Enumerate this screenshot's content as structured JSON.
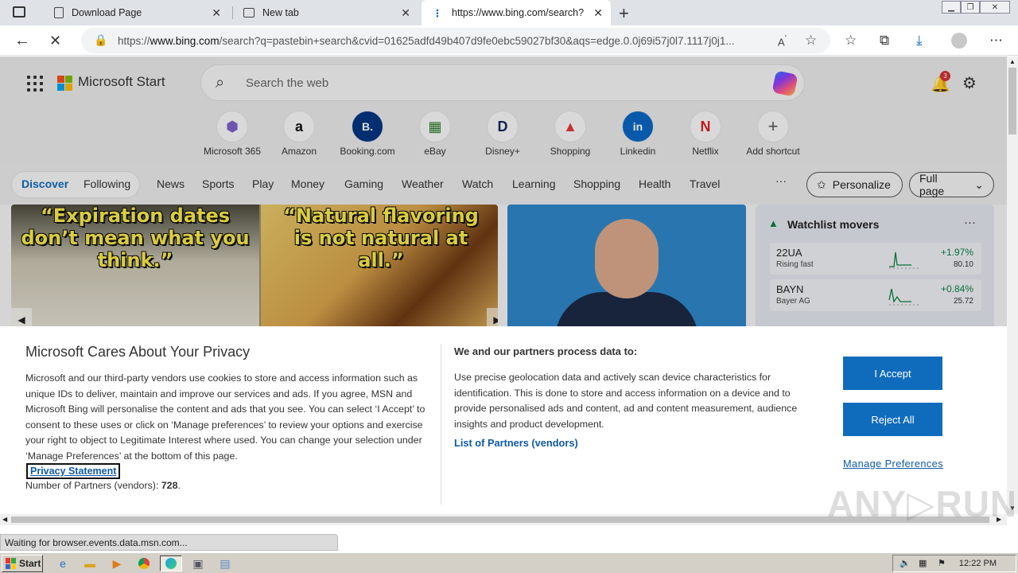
{
  "browser": {
    "tabs": [
      {
        "title": "Download Page"
      },
      {
        "title": "New tab"
      },
      {
        "title": "https://www.bing.com/search?"
      }
    ],
    "url_prefix": "https://",
    "url_host": "www.bing.com",
    "url_rest": "/search?q=pastebin+search&cvid=01625adfd49b407d9fe0ebc59027bf30&aqs=edge.0.0j69i57j0l7.1117j0j1..."
  },
  "header": {
    "brand": "Microsoft Start",
    "search_placeholder": "Search the web",
    "notification_count": "3"
  },
  "shortcuts": [
    {
      "label": "Microsoft 365",
      "glyph": "⬢",
      "color": "#7b61c9"
    },
    {
      "label": "Amazon",
      "glyph": "a",
      "color": "#111111"
    },
    {
      "label": "Booking.com",
      "glyph": "B.",
      "color": "#ffffff"
    },
    {
      "label": "eBay",
      "glyph": "▦",
      "color": "#2a7a2a"
    },
    {
      "label": "Disney+",
      "glyph": "D",
      "color": "#1a2a5a"
    },
    {
      "label": "Shopping",
      "glyph": "▲",
      "color": "#e03a3a"
    },
    {
      "label": "Linkedin",
      "glyph": "in",
      "color": "#ffffff"
    },
    {
      "label": "Netflix",
      "glyph": "N",
      "color": "#d81f26"
    },
    {
      "label": "Add shortcut",
      "glyph": "+",
      "color": "#555555"
    }
  ],
  "nav": {
    "discover": "Discover",
    "following": "Following",
    "items": [
      "News",
      "Sports",
      "Play",
      "Money",
      "Gaming",
      "Weather",
      "Watch",
      "Learning",
      "Shopping",
      "Health",
      "Travel"
    ],
    "more": "···",
    "personalize": "Personalize",
    "full_page": "Full page"
  },
  "feed": {
    "quote_left": "“Expiration dates don’t mean what you think.”",
    "quote_right": "“Natural flavoring is not natural at all.”"
  },
  "watchlist": {
    "title": "Watchlist movers",
    "rows": [
      {
        "symbol": "22UA",
        "sub": "Rising fast",
        "pct": "+1.97%",
        "value": "80.10"
      },
      {
        "symbol": "BAYN",
        "sub": "Bayer AG",
        "pct": "+0.84%",
        "value": "25.72"
      }
    ]
  },
  "consent": {
    "title": "Microsoft Cares About Your Privacy",
    "body": "Microsoft and our third-party vendors use cookies to store and access information such as unique IDs to deliver, maintain and improve our services and ads. If you agree, MSN and Microsoft Bing will personalise the content and ads that you see. You can select ‘I Accept’ to consent to these uses or click on ‘Manage preferences’ to review your options and exercise your right to object to Legitimate Interest where used.  You can change your selection under ‘Manage Preferences’ at the bottom of this page.",
    "privacy_link": "Privacy Statement",
    "partners_label": "Number of Partners (vendors): ",
    "partners_count": "728",
    "partners_dot": ".",
    "heading2": "We and our partners process data to:",
    "body2": "Use precise geolocation data and actively scan device characteristics for identification. This is done to store and access information on a device and to provide personalised ads and content, ad and content measurement, audience insights and product development.",
    "list_link": "List of Partners (vendors)",
    "accept": "I Accept",
    "reject": "Reject All",
    "manage": "Manage Preferences"
  },
  "status": "Waiting for browser.events.data.msn.com...",
  "watermark": "ANY▷RUN",
  "taskbar": {
    "start": "Start",
    "clock": "12:22 PM"
  }
}
